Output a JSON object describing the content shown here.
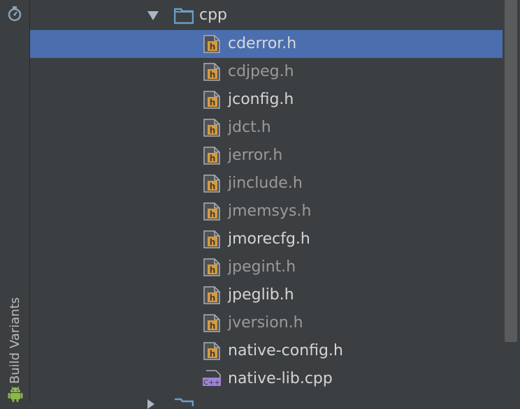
{
  "side_panel": {
    "build_variants_label": "Build Variants"
  },
  "tree": {
    "folder_label": "cpp",
    "selected_index": 0,
    "files": [
      {
        "name": "cderror.h",
        "type": "header",
        "style": "selected"
      },
      {
        "name": "cdjpeg.h",
        "type": "header",
        "style": "dim"
      },
      {
        "name": "jconfig.h",
        "type": "header",
        "style": "bright"
      },
      {
        "name": "jdct.h",
        "type": "header",
        "style": "dim"
      },
      {
        "name": "jerror.h",
        "type": "header",
        "style": "dim"
      },
      {
        "name": "jinclude.h",
        "type": "header",
        "style": "dim"
      },
      {
        "name": "jmemsys.h",
        "type": "header",
        "style": "dim"
      },
      {
        "name": "jmorecfg.h",
        "type": "header",
        "style": "bright"
      },
      {
        "name": "jpegint.h",
        "type": "header",
        "style": "dim"
      },
      {
        "name": "jpeglib.h",
        "type": "header",
        "style": "bright"
      },
      {
        "name": "jversion.h",
        "type": "header",
        "style": "dim"
      },
      {
        "name": "native-config.h",
        "type": "header",
        "style": "bright"
      },
      {
        "name": "native-lib.cpp",
        "type": "cpp",
        "style": "bright"
      }
    ],
    "icons": {
      "header": "header-file-icon",
      "cpp": "cpp-file-icon",
      "folder": "folder-icon",
      "expand": "triangle-down-icon"
    }
  },
  "colors": {
    "background": "#3c3f41",
    "selection": "#4b6eaf",
    "header_icon_orange": "#d99a3d",
    "cpp_icon_purple": "#9f82d6",
    "folder_blue": "#6a9fc9"
  }
}
